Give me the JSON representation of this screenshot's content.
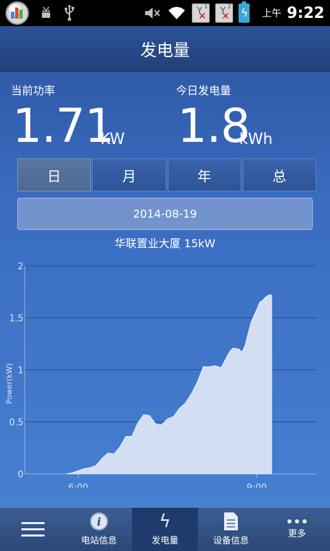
{
  "status_bar": {
    "icons": [
      "app-chart-icon",
      "android-debug-icon",
      "usb-icon",
      "volume-muted-icon",
      "wifi-icon",
      "sim1-no-signal-icon",
      "sim2-no-signal-icon",
      "battery-charging-icon"
    ],
    "sim1_label": "1",
    "sim2_label": "2",
    "ampm": "上午",
    "time": "9:22"
  },
  "title": "发电量",
  "current_power": {
    "label": "当前功率",
    "value": "1.71",
    "unit": "KW"
  },
  "today_energy": {
    "label": "今日发电量",
    "value": "1.8",
    "unit": "kWh"
  },
  "tabs": [
    {
      "label": "日",
      "active": true
    },
    {
      "label": "月",
      "active": false
    },
    {
      "label": "年",
      "active": false
    },
    {
      "label": "总",
      "active": false
    }
  ],
  "date": "2014-08-19",
  "station": "华联置业大厦 15kW",
  "chart_data": {
    "type": "area",
    "ylabel": "Power(kW)",
    "xlabel": "",
    "ylim": [
      0,
      2
    ],
    "yticks": [
      "0",
      "0.5",
      "1",
      "1.5",
      "2"
    ],
    "xticks": [
      {
        "hour": 6,
        "label": "6:00"
      },
      {
        "hour": 9,
        "label": "9:00"
      }
    ],
    "xlim": [
      5.1,
      10.0
    ],
    "grid": true,
    "fill_color": "#d3def2",
    "x": [
      5.8,
      5.9,
      6.0,
      6.1,
      6.2,
      6.3,
      6.4,
      6.5,
      6.6,
      6.7,
      6.8,
      6.9,
      7.0,
      7.05,
      7.1,
      7.2,
      7.3,
      7.4,
      7.5,
      7.6,
      7.7,
      7.8,
      7.9,
      8.0,
      8.1,
      8.2,
      8.3,
      8.4,
      8.5,
      8.55,
      8.6,
      8.7,
      8.75,
      8.8,
      8.9,
      8.95,
      9.0,
      9.05,
      9.1,
      9.15,
      9.2,
      9.25
    ],
    "y": [
      0.0,
      0.01,
      0.03,
      0.05,
      0.06,
      0.08,
      0.15,
      0.2,
      0.19,
      0.26,
      0.36,
      0.36,
      0.49,
      0.53,
      0.57,
      0.56,
      0.48,
      0.47,
      0.53,
      0.55,
      0.63,
      0.68,
      0.77,
      0.88,
      1.03,
      1.03,
      1.04,
      1.02,
      1.13,
      1.18,
      1.21,
      1.2,
      1.17,
      1.23,
      1.45,
      1.52,
      1.58,
      1.65,
      1.67,
      1.7,
      1.72,
      1.72
    ]
  },
  "bottom_nav": [
    {
      "label": "",
      "icon": "menu-icon",
      "active": false
    },
    {
      "label": "电站信息",
      "icon": "info-icon",
      "active": false
    },
    {
      "label": "发电量",
      "icon": "bolt-icon",
      "active": true
    },
    {
      "label": "设备信息",
      "icon": "document-icon",
      "active": false
    },
    {
      "label": "更多",
      "icon": "more-icon",
      "active": false
    }
  ]
}
